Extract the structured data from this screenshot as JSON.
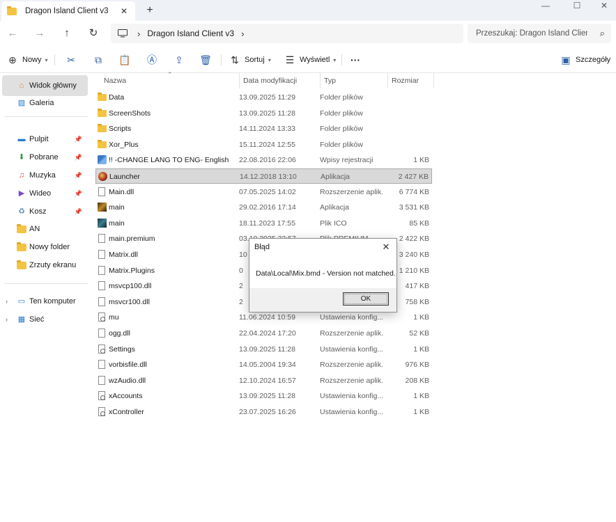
{
  "window": {
    "tab_title": "Dragon Island Client  v3",
    "tab_close": "✕",
    "new_tab": "+",
    "minimize": "—",
    "maximize": "☐",
    "close": "✕"
  },
  "address": {
    "path": [
      "Dragon Island Client  v3"
    ],
    "search_placeholder": "Przeszukaj: Dragon Island Client  v3"
  },
  "toolbar": {
    "new_label": "Nowy",
    "sort_label": "Sortuj",
    "view_label": "Wyświetl",
    "more_label": "···",
    "details_label": "Szczegóły"
  },
  "sidebar": {
    "items": [
      {
        "label": "Widok główny",
        "icon": "home-icon",
        "selected": true
      },
      {
        "label": "Galeria",
        "icon": "gallery-icon"
      },
      {
        "label": "Pulpit",
        "icon": "desktop-icon",
        "pinned": true
      },
      {
        "label": "Pobrane",
        "icon": "download-icon",
        "pinned": true
      },
      {
        "label": "Muzyka",
        "icon": "music-icon",
        "pinned": true
      },
      {
        "label": "Wideo",
        "icon": "video-icon",
        "pinned": true
      },
      {
        "label": "Kosz",
        "icon": "recycle-bin-icon",
        "pinned": true
      },
      {
        "label": "AN",
        "icon": "folder-icon"
      },
      {
        "label": "Nowy folder",
        "icon": "folder-icon"
      },
      {
        "label": "Zrzuty ekranu",
        "icon": "folder-icon"
      },
      {
        "label": "Ten komputer",
        "icon": "computer-icon"
      },
      {
        "label": "Sieć",
        "icon": "network-icon"
      }
    ]
  },
  "columns": {
    "name": "Nazwa",
    "date": "Data modyfikacji",
    "type": "Typ",
    "size": "Rozmiar"
  },
  "files": [
    {
      "name": "Data",
      "date": "13.09.2025 11:29",
      "type": "Folder plików",
      "size": "",
      "icon": "folder"
    },
    {
      "name": "ScreenShots",
      "date": "13.09.2025 11:28",
      "type": "Folder plików",
      "size": "",
      "icon": "folder"
    },
    {
      "name": "Scripts",
      "date": "14.11.2024 13:33",
      "type": "Folder plików",
      "size": "",
      "icon": "folder"
    },
    {
      "name": "Xor_Plus",
      "date": "15.11.2024 12:55",
      "type": "Folder plików",
      "size": "",
      "icon": "folder"
    },
    {
      "name": "!! -CHANGE LANG TO ENG- English",
      "date": "22.08.2016 22:06",
      "type": "Wpisy rejestracji",
      "size": "1 KB",
      "icon": "reg"
    },
    {
      "name": "Launcher",
      "date": "14.12.2018 13:10",
      "type": "Aplikacja",
      "size": "2 427 KB",
      "icon": "app",
      "selected": true
    },
    {
      "name": "Main.dll",
      "date": "07.05.2025 14:02",
      "type": "Rozszerzenie aplik...",
      "size": "6 774 KB",
      "icon": "file"
    },
    {
      "name": "main",
      "date": "29.02.2016 17:14",
      "type": "Aplikacja",
      "size": "3 531 KB",
      "icon": "game"
    },
    {
      "name": "main",
      "date": "18.11.2023 17:55",
      "type": "Plik ICO",
      "size": "85 KB",
      "icon": "mu"
    },
    {
      "name": "main.premium",
      "date": "03.10.2025 22:57",
      "type": "Plik PREMIUM",
      "size": "2 422 KB",
      "icon": "file"
    },
    {
      "name": "Matrix.dll",
      "date": "10",
      "type": "",
      "size": "3 240 KB",
      "icon": "file"
    },
    {
      "name": "Matrix.Plugins",
      "date": "0",
      "type": "",
      "size": "1 210 KB",
      "icon": "file"
    },
    {
      "name": "msvcp100.dll",
      "date": "2",
      "type": "",
      "size": "417 KB",
      "icon": "file"
    },
    {
      "name": "msvcr100.dll",
      "date": "2",
      "type": "",
      "size": "758 KB",
      "icon": "file"
    },
    {
      "name": "mu",
      "date": "11.06.2024 10:59",
      "type": "Ustawienia konfig...",
      "size": "1 KB",
      "icon": "settings"
    },
    {
      "name": "ogg.dll",
      "date": "22.04.2024 17:20",
      "type": "Rozszerzenie aplik...",
      "size": "52 KB",
      "icon": "file"
    },
    {
      "name": "Settings",
      "date": "13.09.2025 11:28",
      "type": "Ustawienia konfig...",
      "size": "1 KB",
      "icon": "settings"
    },
    {
      "name": "vorbisfile.dll",
      "date": "14.05.2004 19:34",
      "type": "Rozszerzenie aplik...",
      "size": "976 KB",
      "icon": "file"
    },
    {
      "name": "wzAudio.dll",
      "date": "12.10.2024 16:57",
      "type": "Rozszerzenie aplik...",
      "size": "208 KB",
      "icon": "file"
    },
    {
      "name": "xAccounts",
      "date": "13.09.2025 11:28",
      "type": "Ustawienia konfig...",
      "size": "1 KB",
      "icon": "settings"
    },
    {
      "name": "xController",
      "date": "23.07.2025 16:26",
      "type": "Ustawienia konfig...",
      "size": "1 KB",
      "icon": "settings"
    }
  ],
  "dialog": {
    "title": "Błąd",
    "close": "✕",
    "message": "Data\\Local\\Mix.bmd - Version not matched.",
    "ok_label": "OK"
  }
}
